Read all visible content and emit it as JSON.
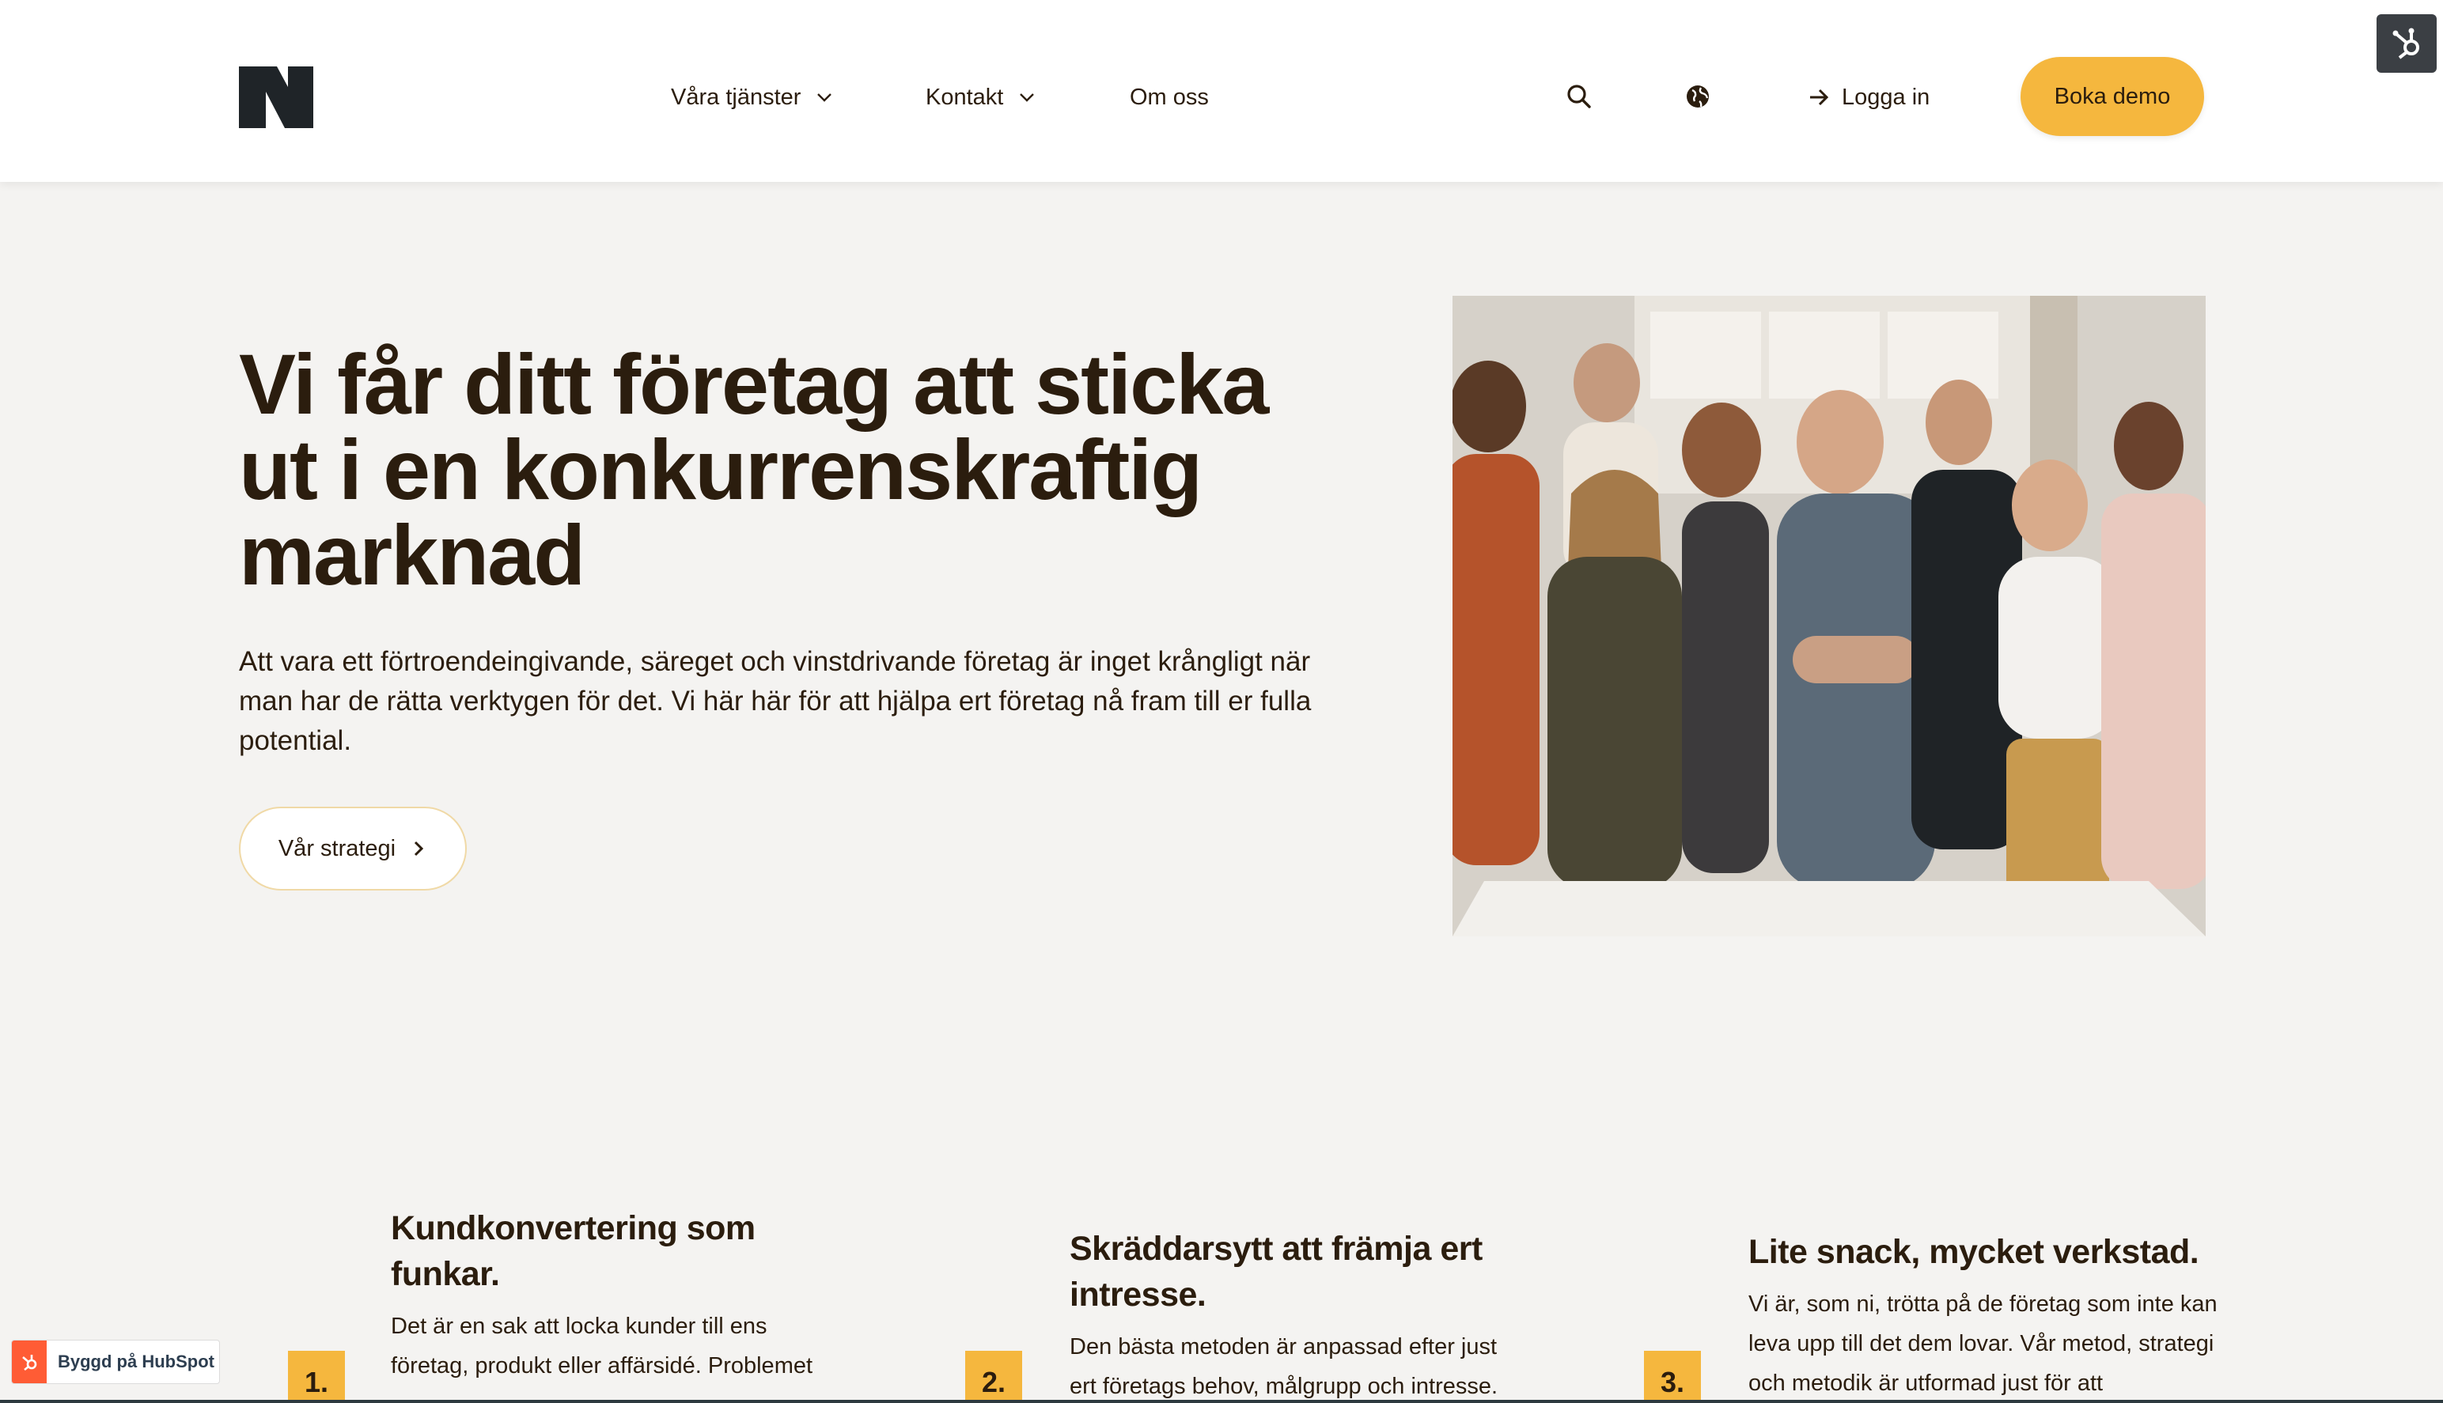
{
  "header": {
    "nav": [
      {
        "label": "Våra tjänster",
        "has_dropdown": true
      },
      {
        "label": "Kontakt",
        "has_dropdown": true
      },
      {
        "label": "Om oss",
        "has_dropdown": false
      }
    ],
    "login_label": "Logga in",
    "demo_label": "Boka demo",
    "icons": [
      "search-icon",
      "globe-icon",
      "arrow-right-icon",
      "hubspot-sprocket-icon"
    ]
  },
  "hero": {
    "title_lines": [
      "Vi får ditt företag att sticka",
      "ut i en konkurrenskraftig",
      "marknad"
    ],
    "text": "Att vara ett förtroendeingivande, säreget och vinstdrivande företag är inget krångligt när man har de rätta verktygen för det. Vi här här för att hjälpa ert företag nå fram till er fulla potential.",
    "button_label": "Vår strategi",
    "image_alt": "Group of smiling colleagues"
  },
  "features": [
    {
      "number": "1.",
      "title": "Kundkonvertering som funkar.",
      "text": "Det är en sak att locka kunder till ens företag, produkt eller affärsidé. Problemet"
    },
    {
      "number": "2.",
      "title": "Skräddarsytt att främja ert intresse.",
      "text": "Den bästa metoden är anpassad efter just ert företags behov, målgrupp och intresse."
    },
    {
      "number": "3.",
      "title": "Lite snack, mycket verkstad.",
      "text": "Vi är, som ni, trötta på de företag som inte kan leva upp till det dem lovar. Vår metod, strategi och metodik är utformad just för att"
    }
  ],
  "hubspot_badge": {
    "label": "Byggd på HubSpot"
  },
  "colors": {
    "accent": "#f5b73e",
    "text": "#2b1d0e",
    "background": "#f4f3f1",
    "hubspot": "#ff5c35"
  }
}
